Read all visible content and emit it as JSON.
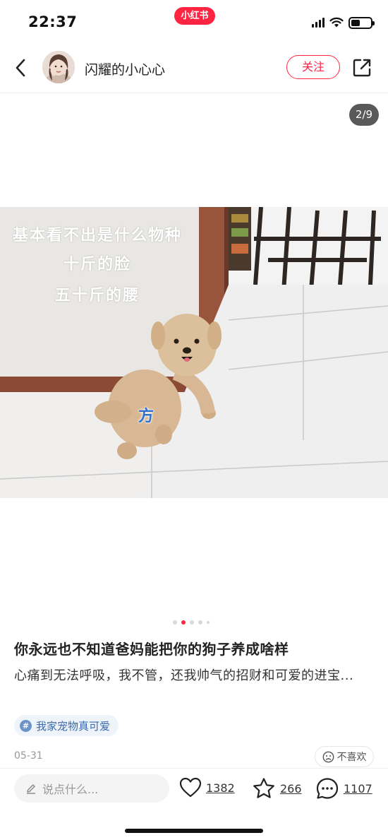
{
  "status_bar": {
    "time": "22:37",
    "app_pill": "小红书",
    "icons": [
      "signal-icon",
      "wifi-icon",
      "battery-icon"
    ],
    "battery_level": 0.45
  },
  "header": {
    "back_icon": "chevron-left-icon",
    "author_name": "闪耀的小心心",
    "follow_label": "关注",
    "share_icon": "share-icon"
  },
  "media": {
    "page_indicator": "2/9",
    "caption_lines": [
      "基本看不出是什么物种",
      "十斤的脸",
      "五十斤的腰"
    ],
    "sticker_text": "方",
    "dots_total": 5,
    "dots_active_index": 1
  },
  "note": {
    "title": "你永远也不知道爸妈能把你的狗子养成啥样",
    "description": "心痛到无法呼吸，我不管，还我帅气的招财和可爱的进宝...",
    "tag_icon_text": "#",
    "tag": "我家宠物真可爱",
    "date": "05-31",
    "dislike_label": "不喜欢"
  },
  "bottom_bar": {
    "comment_placeholder": "说点什么...",
    "likes": "1382",
    "collects": "266",
    "comments": "1107"
  },
  "colors": {
    "brand": "#ff2442",
    "tag_text": "#3a6aad",
    "tag_bg": "#eff4fb"
  }
}
